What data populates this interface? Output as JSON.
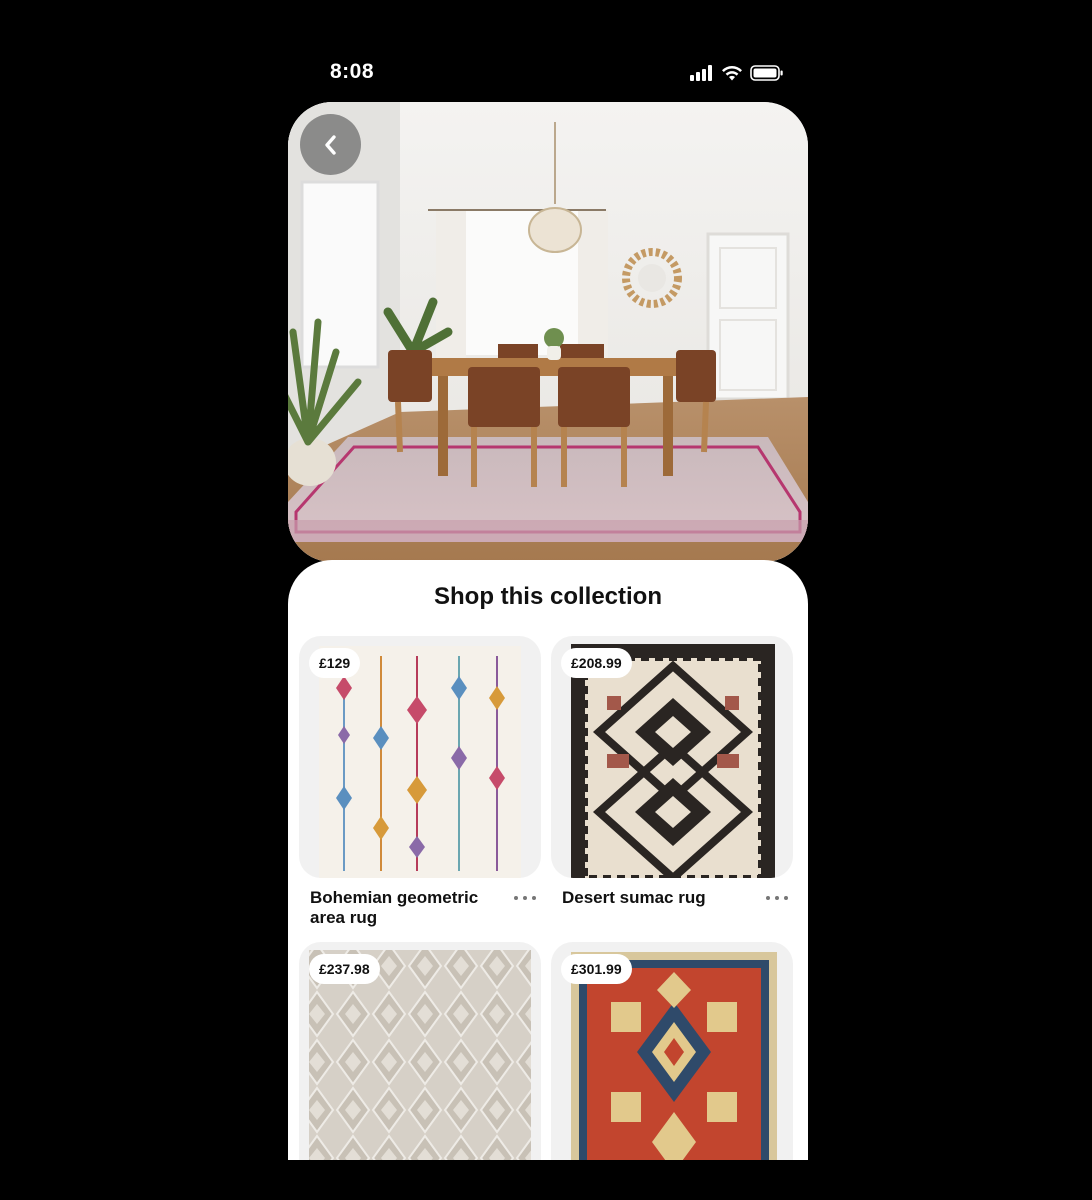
{
  "status_bar": {
    "time": "8:08",
    "icons": [
      "cellular-signal-icon",
      "wifi-icon",
      "battery-icon"
    ]
  },
  "hero": {
    "image": "dining-room-photo",
    "back_icon": "chevron-left-icon"
  },
  "collection": {
    "title": "Shop this collection",
    "products": [
      {
        "price": "£129",
        "name": "Bohemian geometric area rug",
        "image": "bohemian-rug-image"
      },
      {
        "price": "£208.99",
        "name": "Desert sumac rug",
        "image": "desert-sumac-rug-image"
      },
      {
        "price": "£237.98",
        "name": "",
        "image": "grey-diamond-rug-image"
      },
      {
        "price": "£301.99",
        "name": "",
        "image": "red-persian-rug-image"
      }
    ],
    "more_icon": "ellipsis-icon"
  },
  "colors": {
    "background": "#000000",
    "sheet": "#ffffff",
    "text": "#111111",
    "muted": "#767676",
    "card_bg": "#f1f1f1"
  }
}
